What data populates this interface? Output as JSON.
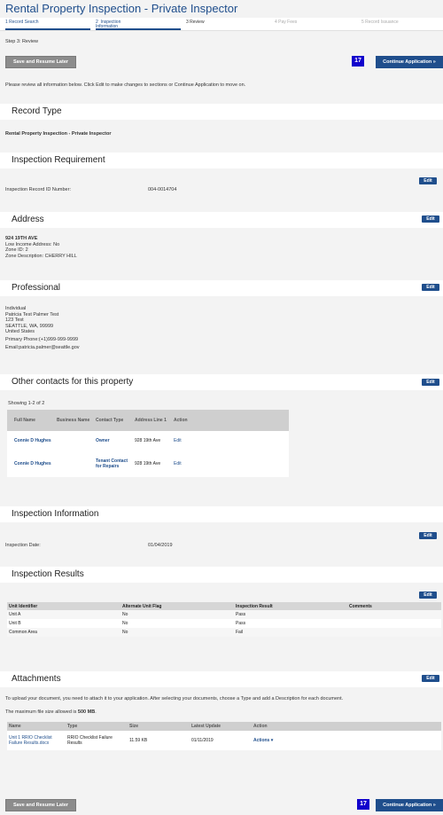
{
  "page_title": "Rental Property Inspection - Private Inspector",
  "steps": [
    {
      "label": "1  Record Search"
    },
    {
      "label": "2  Inspection\nInformation"
    },
    {
      "label": "3  Review"
    },
    {
      "label": "4  Pay Fees"
    },
    {
      "label": "5  Record Issuance"
    }
  ],
  "step_heading": "Step 3: Review",
  "buttons": {
    "save_resume": "Save and Resume Later",
    "continue": "Continue Application »",
    "badge": "17",
    "edit": "Edit"
  },
  "instructions": "Please review all information below. Click Edit to make changes to sections or Continue Application to move on.",
  "record_type": {
    "heading": "Record Type",
    "value": "Rental Property Inspection - Private Inspector"
  },
  "inspection_requirement": {
    "heading": "Inspection Requirement",
    "label": "Inspection Record ID Number:",
    "value": "004-0014704"
  },
  "address": {
    "heading": "Address",
    "street": "924 19TH AVE",
    "low_income": "Low Income Address: No",
    "zone_id": "Zone ID: 2",
    "zone_desc": "Zone Description: CHERRY HILL"
  },
  "professional": {
    "heading": "Professional",
    "type": "Individual",
    "name": "Patricia Test Palmer Test",
    "street": "123 Test",
    "city": "SEATTLE, WA, 99999",
    "country": "United States",
    "phone": "Primary Phone:(+1)999-999-9999",
    "email": "Email:patricia.palmer@seattle.gov"
  },
  "contacts": {
    "heading": "Other contacts for this property",
    "showing": "Showing 1-2 of 2",
    "headers": [
      "Full Name",
      "Business Name",
      "Contact Type",
      "Address Line 1",
      "Action"
    ],
    "rows": [
      {
        "name": "Connie D Hughes",
        "business": "",
        "type": "Owner",
        "address": "928 19th Ave",
        "action": "Edit"
      },
      {
        "name": "Connie D Hughes",
        "business": "",
        "type": "Tenant Contact for Repairs",
        "address": "928 19th Ave",
        "action": "Edit"
      }
    ]
  },
  "inspection_info": {
    "heading": "Inspection Information",
    "label": "Inspection Date:",
    "value": "01/04/2019"
  },
  "inspection_results": {
    "heading": "Inspection Results",
    "headers": [
      "Unit Identifier",
      "Alternate Unit Flag",
      "Inspection Result",
      "Comments"
    ],
    "rows": [
      [
        "Unit A",
        "No",
        "Pass",
        ""
      ],
      [
        "Unit B",
        "No",
        "Pass",
        ""
      ],
      [
        "Common Area",
        "No",
        "Fail",
        ""
      ]
    ]
  },
  "attachments": {
    "heading": "Attachments",
    "info": "To upload your document, you need to attach it to your application. After selecting your documents, choose a Type and add a Description for each document.",
    "max_prefix": "The maximum file size allowed is ",
    "max_value": "500 MB",
    "max_suffix": ".",
    "headers": [
      "Name",
      "Type",
      "Size",
      "Latest Update",
      "Action"
    ],
    "rows": [
      {
        "name": "Unit 1 RRIO Checklist Failure Results.docx",
        "type": "RRIO Checklist Failure Results",
        "size": "11.59 KB",
        "updated": "01/11/2019",
        "action": "Actions ▾"
      }
    ]
  }
}
